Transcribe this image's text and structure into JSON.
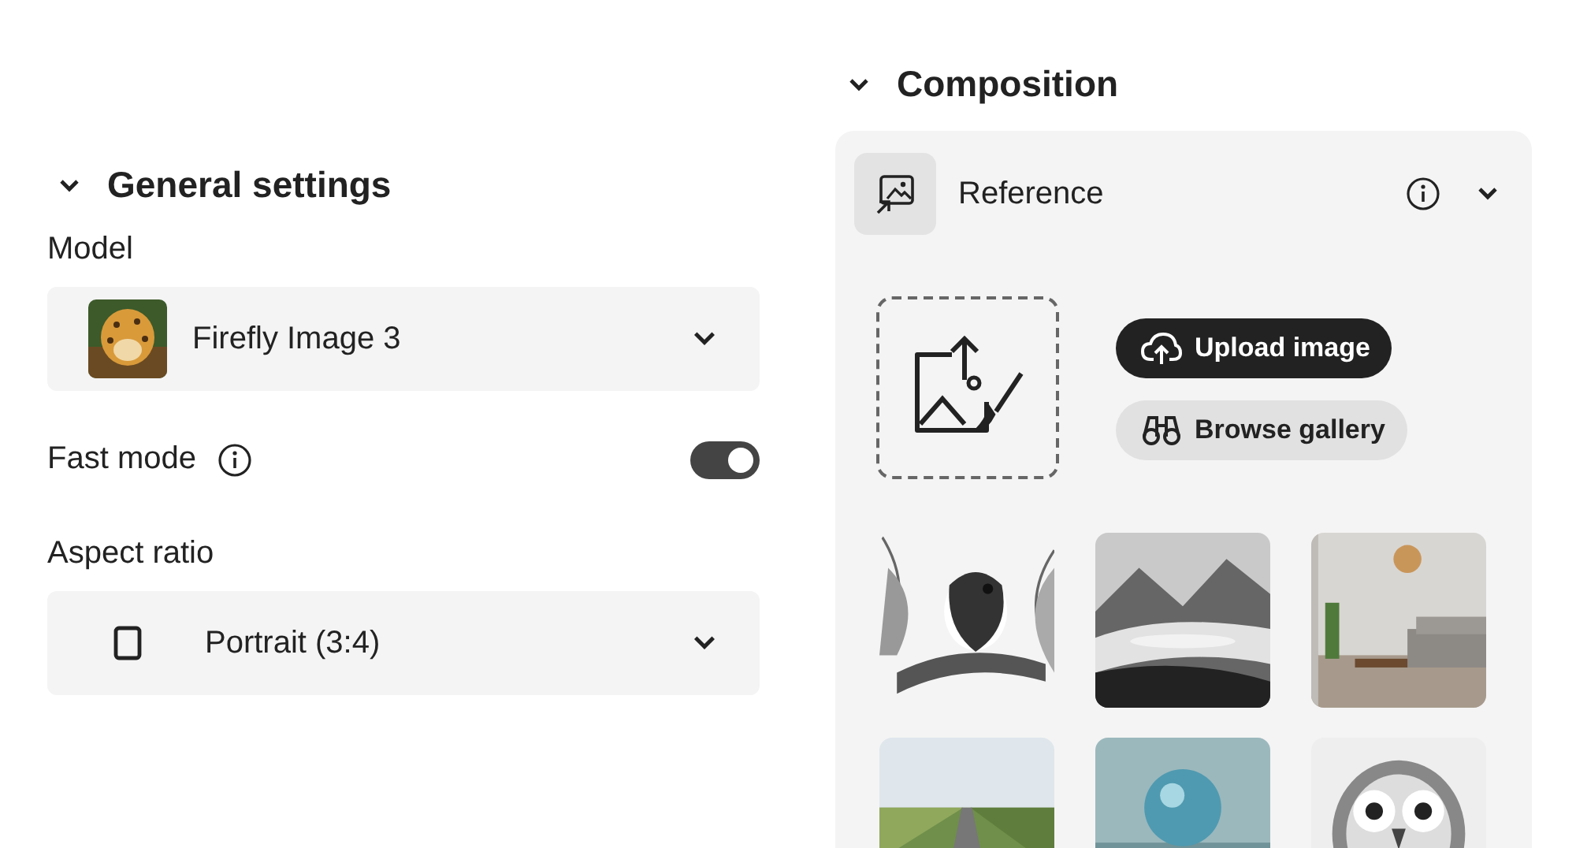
{
  "general_settings": {
    "title": "General settings",
    "expanded": true,
    "model": {
      "label": "Model",
      "value": "Firefly Image 3"
    },
    "fast_mode": {
      "label": "Fast mode",
      "on": true
    },
    "aspect_ratio": {
      "label": "Aspect ratio",
      "value": "Portrait (3:4)"
    }
  },
  "composition": {
    "title": "Composition",
    "expanded": true,
    "reference": {
      "label": "Reference",
      "expanded": true
    },
    "buttons": [
      {
        "label": "Upload image",
        "kind": "primary"
      },
      {
        "label": "Browse gallery",
        "kind": "secondary"
      }
    ]
  }
}
